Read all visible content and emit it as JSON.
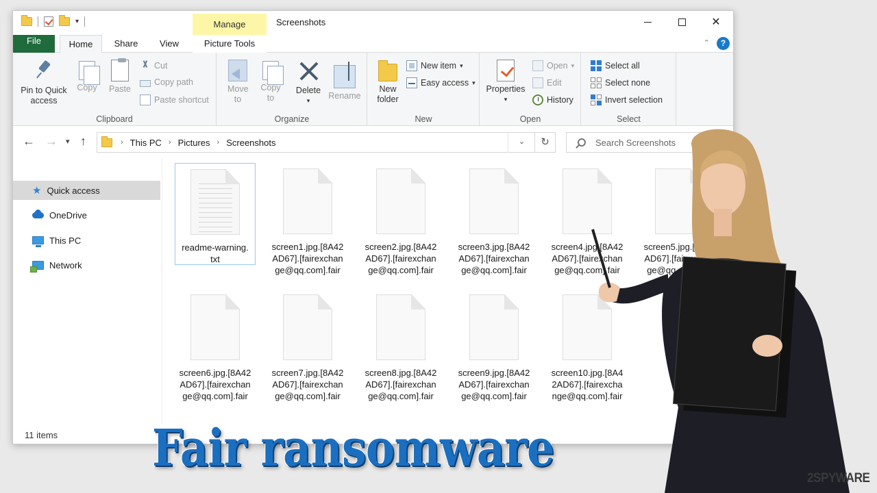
{
  "window": {
    "title": "Screenshots",
    "contextual_tab": "Manage",
    "controls": {
      "minimize": "",
      "maximize": "",
      "close": "✕"
    }
  },
  "tabs": [
    "File",
    "Home",
    "Share",
    "View",
    "Picture Tools"
  ],
  "ribbon": {
    "clipboard": {
      "label": "Clipboard",
      "pin": "Pin to Quick access",
      "copy": "Copy",
      "paste": "Paste",
      "cut": "Cut",
      "copy_path": "Copy path",
      "paste_shortcut": "Paste shortcut"
    },
    "organize": {
      "label": "Organize",
      "move_to": "Move to",
      "copy_to": "Copy to",
      "delete": "Delete",
      "rename": "Rename"
    },
    "new": {
      "label": "New",
      "new_folder": "New folder",
      "new_item": "New item",
      "easy_access": "Easy access"
    },
    "open": {
      "label": "Open",
      "properties": "Properties",
      "open": "Open",
      "edit": "Edit",
      "history": "History"
    },
    "select": {
      "label": "Select",
      "select_all": "Select all",
      "select_none": "Select none",
      "invert": "Invert selection"
    }
  },
  "address": {
    "crumbs": [
      "This PC",
      "Pictures",
      "Screenshots"
    ],
    "search_placeholder": "Search Screenshots"
  },
  "sidebar": {
    "items": [
      {
        "label": "Quick access",
        "icon": "star-icon",
        "active": true
      },
      {
        "label": "OneDrive",
        "icon": "cloud-icon"
      },
      {
        "label": "This PC",
        "icon": "computer-icon"
      },
      {
        "label": "Network",
        "icon": "network-icon"
      }
    ]
  },
  "files": [
    {
      "name": "readme-warning.\ntxt",
      "selected": true,
      "kind": "txt"
    },
    {
      "name": "screen1.jpg.[8A42AD67].[fairexchange@qq.com].fair"
    },
    {
      "name": "screen2.jpg.[8A42AD67].[fairexchange@qq.com].fair"
    },
    {
      "name": "screen3.jpg.[8A42AD67].[fairexchange@qq.com].fair"
    },
    {
      "name": "screen4.jpg.[8A42AD67].[fairexchange@qq.com].fair"
    },
    {
      "name": "screen5.jpg.[8A42AD67].[fairexchange@qq.com].fair"
    },
    {
      "name": "screen6.jpg.[8A42AD67].[fairexchange@qq.com].fair"
    },
    {
      "name": "screen7.jpg.[8A42AD67].[fairexchange@qq.com].fair"
    },
    {
      "name": "screen8.jpg.[8A42AD67].[fairexchange@qq.com].fair"
    },
    {
      "name": "screen9.jpg.[8A42AD67].[fairexchange@qq.com].fair"
    },
    {
      "name": "screen10.jpg.[8A42AD67].[fairexchange@qq.com].fair"
    }
  ],
  "status": {
    "items": "11 items"
  },
  "overlay": {
    "headline": "Fair ransomware",
    "brand": "2SPYWARE"
  },
  "colors": {
    "file_tab": "#1f6b3b",
    "manage_tab": "#fdf6a7",
    "headline": "#1b6fc0",
    "accent": "#1979ca"
  }
}
